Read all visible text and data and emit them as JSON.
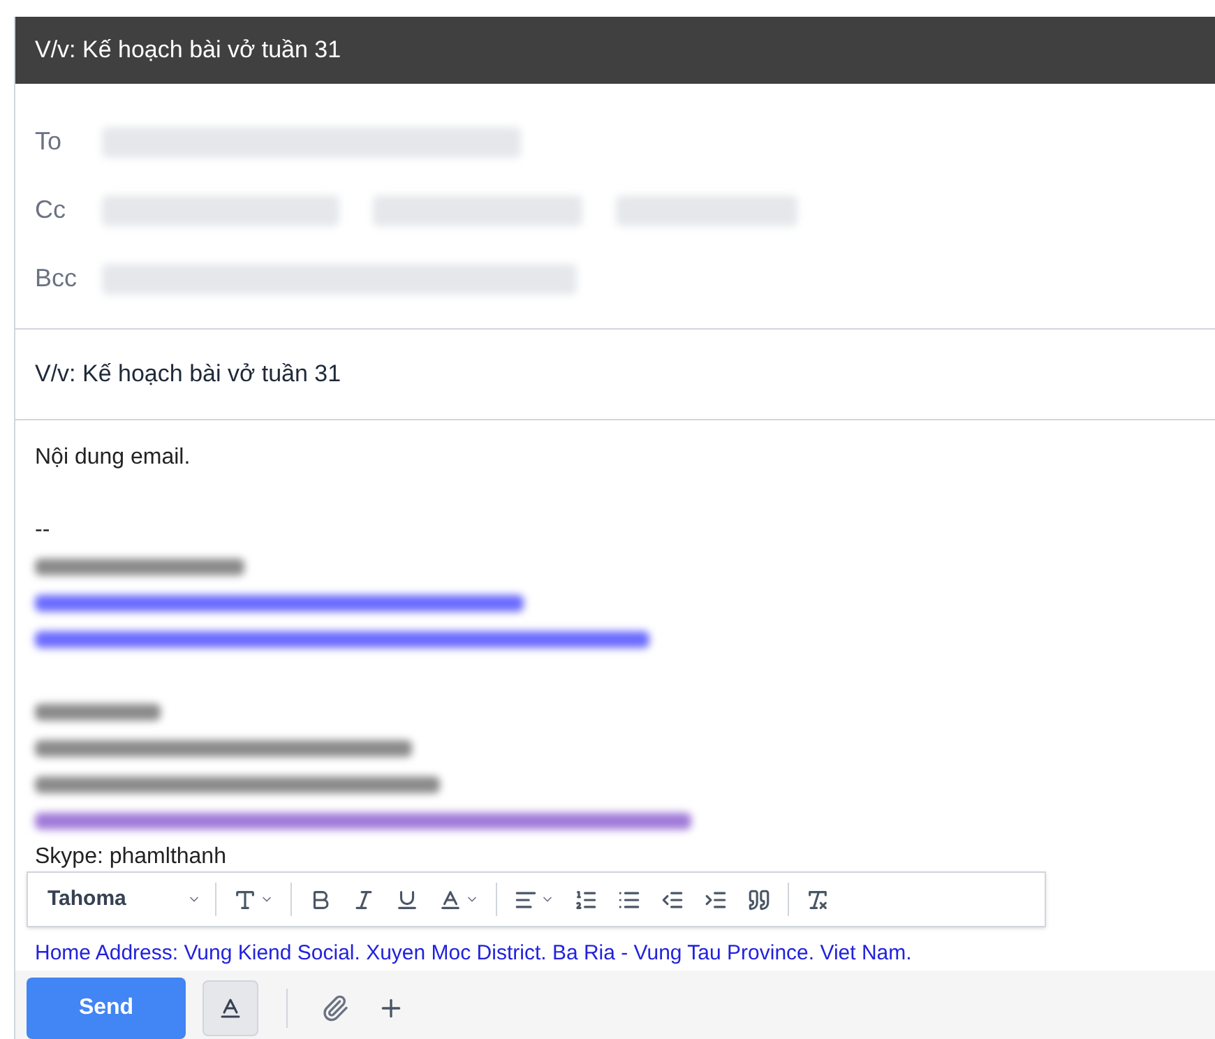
{
  "window": {
    "title": "V/v: Kế hoạch bài vở tuần 31"
  },
  "recipients": [
    {
      "label": "To",
      "chips": [
        {
          "kind": "redacted"
        }
      ]
    },
    {
      "label": "Cc",
      "chips": [
        {
          "kind": "redacted"
        },
        {
          "kind": "redacted"
        },
        {
          "kind": "redacted"
        }
      ]
    },
    {
      "label": "Bcc",
      "chips": [
        {
          "kind": "redacted"
        }
      ]
    }
  ],
  "subject": {
    "value": "V/v: Kế hoạch bài vở tuần 31"
  },
  "body": {
    "lines": [
      {
        "kind": "text",
        "text": "Nội dung email."
      },
      {
        "kind": "blank"
      },
      {
        "kind": "text",
        "text": "--"
      },
      {
        "kind": "redacted",
        "color": "#8a8a8a"
      },
      {
        "kind": "redacted",
        "color": "#6b6bff"
      },
      {
        "kind": "redacted",
        "color": "#6b6bff"
      },
      {
        "kind": "blank"
      },
      {
        "kind": "redacted",
        "color": "#8a8a8a"
      },
      {
        "kind": "redacted",
        "color": "#8a8a8a"
      },
      {
        "kind": "redacted",
        "color": "#8a8a8a"
      },
      {
        "kind": "redacted",
        "color": "#a07ad8"
      },
      {
        "kind": "text",
        "text": "Skype: phamlthanh"
      },
      {
        "kind": "text",
        "text": "Home Address: Vung Kiend Social. Xuyen Moc District. Ba Ria - Vung Tau Province. Viet Nam."
      }
    ]
  },
  "format_toolbar": {
    "font": "Tahoma"
  },
  "send_button": {
    "label": "Send"
  }
}
